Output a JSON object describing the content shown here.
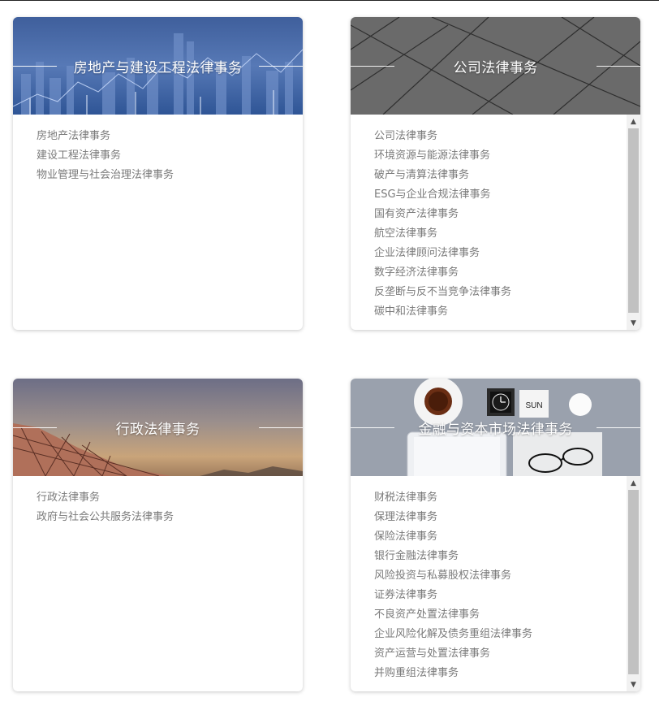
{
  "cards": [
    {
      "title": "房地产与建设工程法律事务",
      "items": [
        "房地产法律事务",
        "建设工程法律事务",
        "物业管理与社会治理法律事务"
      ]
    },
    {
      "title": "公司法律事务",
      "items": [
        "公司法律事务",
        "环境资源与能源法律事务",
        "破产与清算法律事务",
        "ESG与企业合规法律事务",
        "国有资产法律事务",
        "航空法律事务",
        "企业法律顾问法律事务",
        "数字经济法律事务",
        "反垄断与反不当竞争法律事务",
        "碳中和法律事务"
      ]
    },
    {
      "title": "行政法律事务",
      "items": [
        "行政法律事务",
        "政府与社会公共服务法律事务"
      ]
    },
    {
      "title": "金融与资本市场法律事务",
      "items": [
        "财税法律事务",
        "保理法律事务",
        "保险法律事务",
        "银行金融法律事务",
        "风险投资与私募股权法律事务",
        "证券法律事务",
        "不良资产处置法律事务",
        "企业风险化解及债务重组法律事务",
        "资产运营与处置法律事务",
        "并购重组法律事务"
      ]
    }
  ],
  "decor": {
    "clock_label": "SUN"
  },
  "icons": {
    "scroll_up": "chevron-up-icon",
    "scroll_down": "chevron-down-icon"
  }
}
